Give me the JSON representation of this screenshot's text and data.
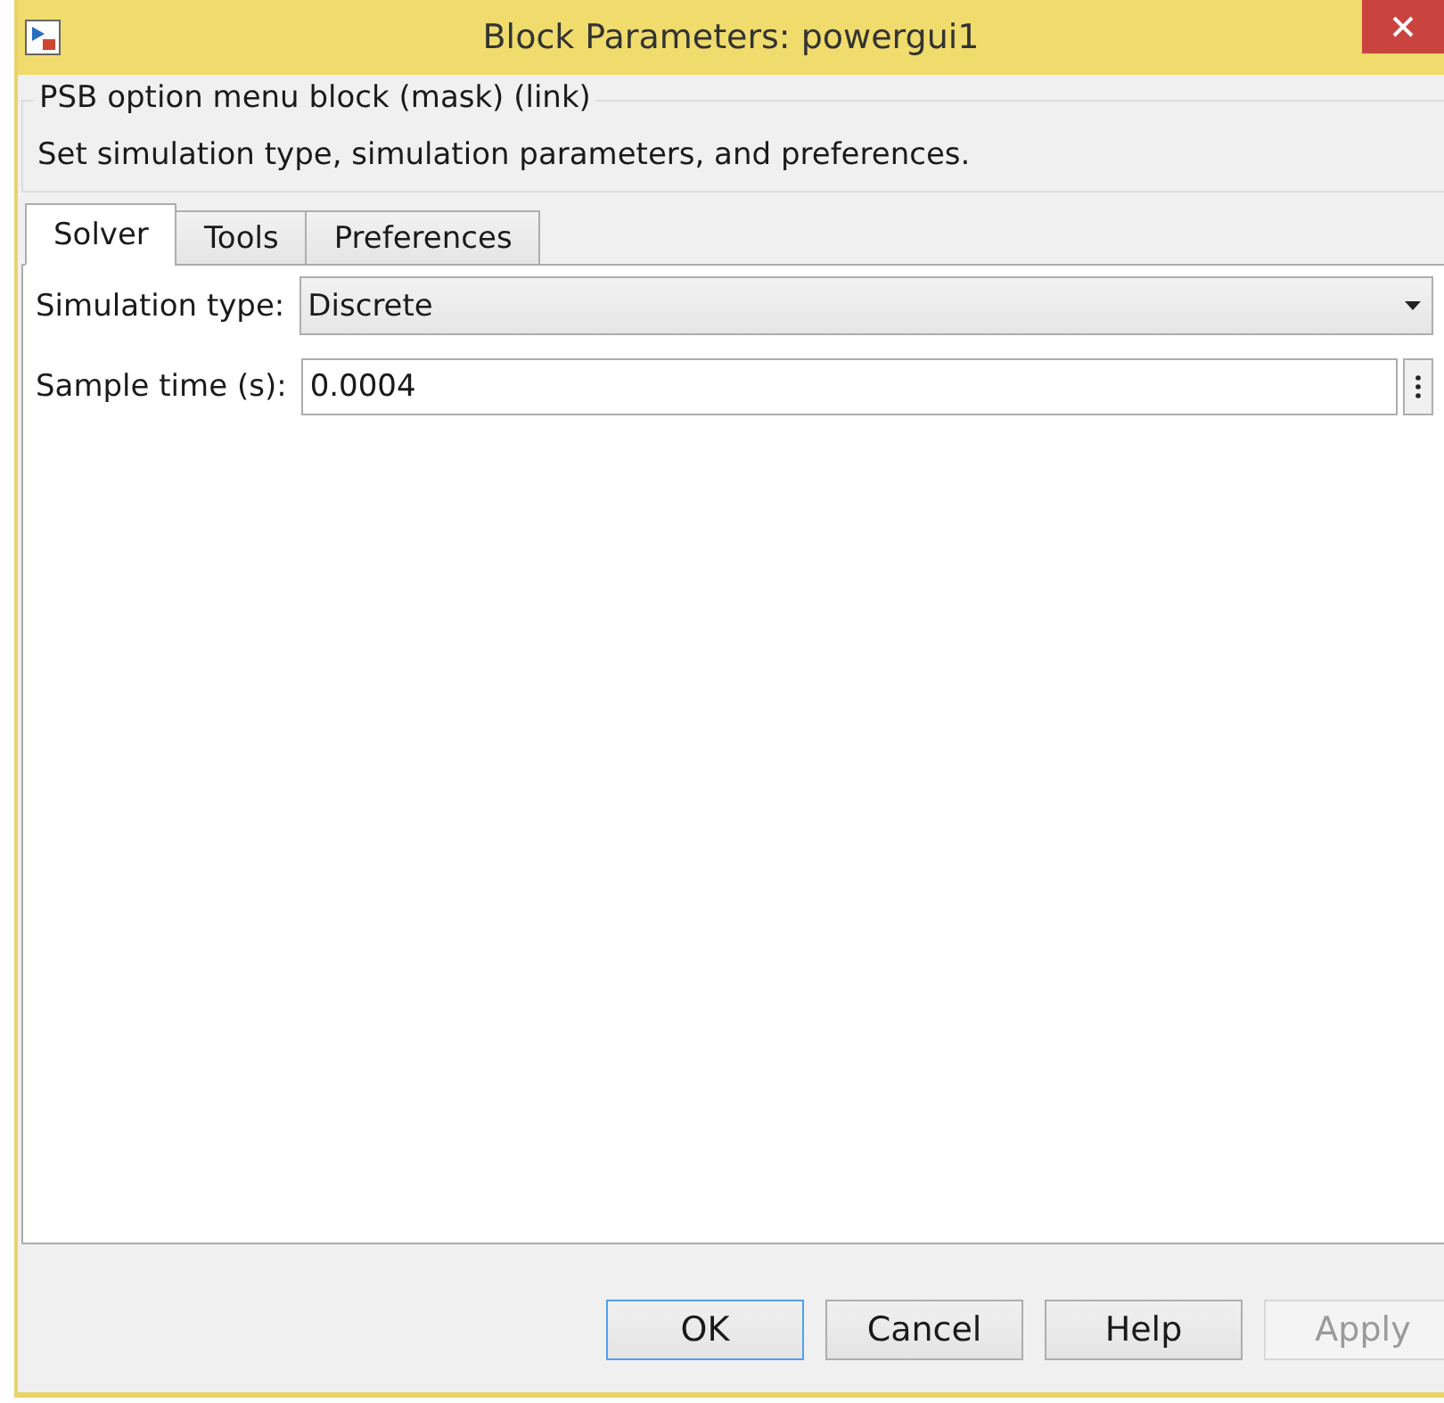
{
  "window": {
    "title": "Block Parameters: powergui1"
  },
  "group": {
    "title": "PSB option menu block (mask) (link)",
    "description": "Set simulation type, simulation parameters, and preferences."
  },
  "tabs": [
    {
      "label": "Solver",
      "selected": true
    },
    {
      "label": "Tools",
      "selected": false
    },
    {
      "label": "Preferences",
      "selected": false
    }
  ],
  "parameters": [
    {
      "kind": "dropdown",
      "label": "Simulation type:",
      "value": "Discrete"
    },
    {
      "kind": "edit",
      "label": "Sample time (s):",
      "value": "0.0004"
    }
  ],
  "buttons": [
    {
      "label": "OK",
      "focused": true,
      "disabled": false
    },
    {
      "label": "Cancel",
      "focused": false,
      "disabled": false
    },
    {
      "label": "Help",
      "focused": false,
      "disabled": false
    },
    {
      "label": "Apply",
      "focused": false,
      "disabled": true
    }
  ]
}
